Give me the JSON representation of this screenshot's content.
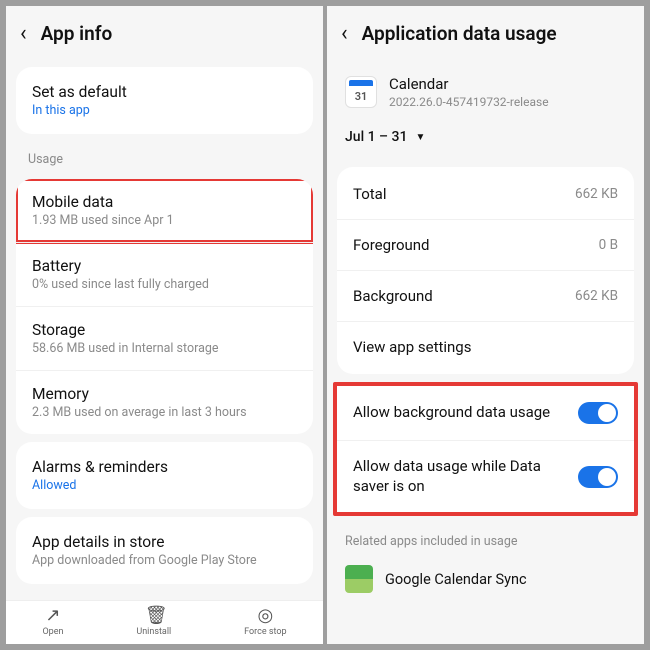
{
  "left": {
    "title": "App info",
    "set_default": {
      "title": "Set as default",
      "sub": "In this app"
    },
    "usage_label": "Usage",
    "mobile_data": {
      "title": "Mobile data",
      "sub": "1.93 MB used since Apr 1"
    },
    "battery": {
      "title": "Battery",
      "sub": "0% used since last fully charged"
    },
    "storage": {
      "title": "Storage",
      "sub": "58.66 MB used in Internal storage"
    },
    "memory": {
      "title": "Memory",
      "sub": "2.3 MB used on average in last 3 hours"
    },
    "alarms": {
      "title": "Alarms & reminders",
      "sub": "Allowed"
    },
    "details": {
      "title": "App details in store",
      "sub": "App downloaded from Google Play Store"
    },
    "bottom": {
      "open": "Open",
      "uninstall": "Uninstall",
      "force_stop": "Force stop"
    }
  },
  "right": {
    "title": "Application data usage",
    "app": {
      "name": "Calendar",
      "version": "2022.26.0-457419732-release",
      "icon_day": "31"
    },
    "period": "Jul 1 – 31",
    "total": {
      "k": "Total",
      "v": "662 KB"
    },
    "foreground": {
      "k": "Foreground",
      "v": "0 B"
    },
    "background": {
      "k": "Background",
      "v": "662 KB"
    },
    "view_settings": "View app settings",
    "toggle_bg": "Allow background data usage",
    "toggle_ds": "Allow data usage while Data saver is on",
    "related_label": "Related apps included in usage",
    "related_app": "Google Calendar Sync"
  }
}
